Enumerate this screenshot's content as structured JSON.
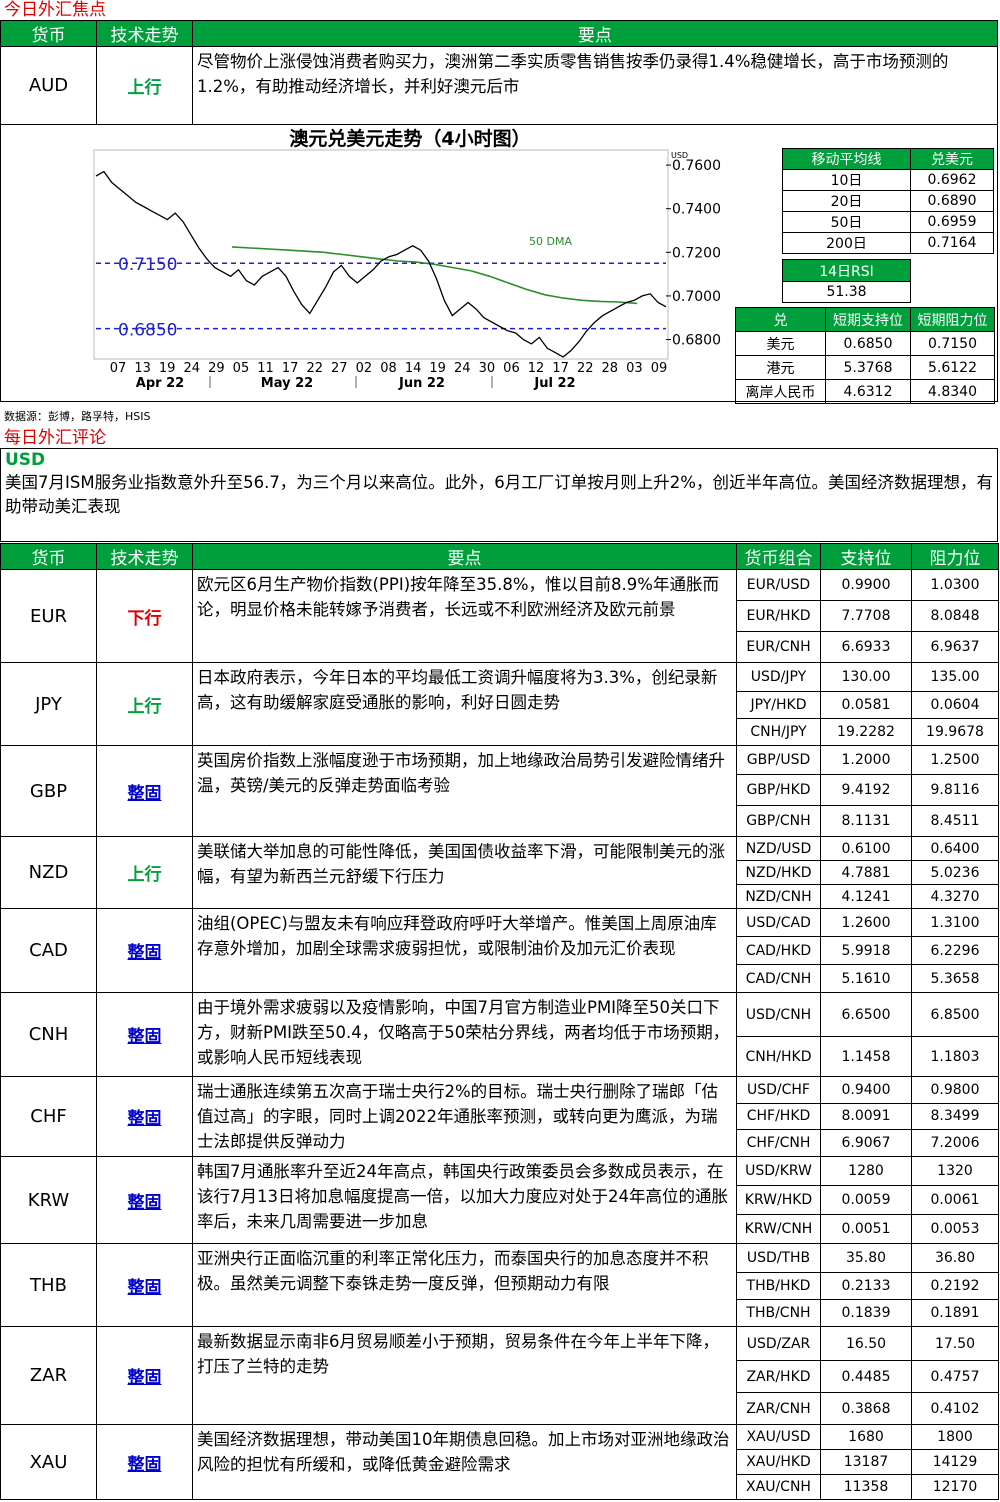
{
  "focus": {
    "title": "今日外汇焦点",
    "headers": {
      "currency": "货币",
      "trend": "技术走势",
      "points": "要点"
    },
    "aud": {
      "currency": "AUD",
      "trend": "上行",
      "points": "尽管物价上涨侵蚀消费者购买力，澳洲第二季实质零售销售按季仍录得1.4%稳健增长，高于市场预测的1.2%，有助推动经济增长，并利好澳元后市"
    }
  },
  "chart_data": {
    "type": "line",
    "title": "澳元兑美元走势（4小时图）",
    "y_unit": "USD",
    "ylim": [
      0.672,
      0.766
    ],
    "y_ticks": [
      "0.7600",
      "0.7400",
      "0.7200",
      "0.7000",
      "0.6800"
    ],
    "x_ticks": [
      "07",
      "13",
      "19",
      "24",
      "29",
      "05",
      "11",
      "17",
      "22",
      "27",
      "02",
      "08",
      "14",
      "19",
      "24",
      "30",
      "06",
      "12",
      "17",
      "22",
      "28",
      "03",
      "09"
    ],
    "month_labels": [
      "Apr 22",
      "May 22",
      "Jun 22",
      "Jul 22"
    ],
    "levels": [
      {
        "label": "0.7150",
        "value": 0.715
      },
      {
        "label": "0.6850",
        "value": 0.685
      }
    ],
    "dma_label": "50 DMA",
    "series": [
      {
        "values": [
          0.755,
          0.757,
          0.752,
          0.749,
          0.746,
          0.743,
          0.741,
          0.739,
          0.737,
          0.735,
          0.738,
          0.734,
          0.728,
          0.722,
          0.717,
          0.713,
          0.711,
          0.709,
          0.712,
          0.707,
          0.705,
          0.709,
          0.711,
          0.713,
          0.709,
          0.702,
          0.696,
          0.692,
          0.698,
          0.704,
          0.711,
          0.714,
          0.709,
          0.706,
          0.709,
          0.712,
          0.716,
          0.718,
          0.719,
          0.721,
          0.723,
          0.721,
          0.716,
          0.708,
          0.698,
          0.691,
          0.694,
          0.697,
          0.694,
          0.69,
          0.688,
          0.686,
          0.684,
          0.683,
          0.68,
          0.678,
          0.681,
          0.676,
          0.674,
          0.672,
          0.675,
          0.679,
          0.684,
          0.688,
          0.691,
          0.693,
          0.695,
          0.697,
          0.698,
          0.7,
          0.701,
          0.697,
          0.695
        ]
      },
      {
        "name": "50 DMA",
        "values": [
          0.7225,
          0.722,
          0.7215,
          0.721,
          0.7205,
          0.72,
          0.719,
          0.718,
          0.717,
          0.716,
          0.7155,
          0.7145,
          0.713,
          0.7115,
          0.709,
          0.706,
          0.703,
          0.7005,
          0.699,
          0.698,
          0.6975,
          0.6972,
          0.6966
        ]
      }
    ]
  },
  "ma_table": {
    "headers": [
      "移动平均线",
      "兑美元"
    ],
    "rows": [
      [
        "10日",
        "0.6962"
      ],
      [
        "20日",
        "0.6890"
      ],
      [
        "50日",
        "0.6959"
      ],
      [
        "200日",
        "0.7164"
      ]
    ]
  },
  "rsi": {
    "label": "14日RSI",
    "value": "51.38"
  },
  "sr_table": {
    "headers": [
      "兑",
      "短期支持位",
      "短期阻力位"
    ],
    "rows": [
      [
        "美元",
        "0.6850",
        "0.7150"
      ],
      [
        "港元",
        "5.3768",
        "5.6122"
      ],
      [
        "离岸人民币",
        "4.6312",
        "4.8340"
      ]
    ]
  },
  "source": "数据源：彭博，路孚特，HSIS",
  "commentary": {
    "title": "每日外汇评论",
    "usd_label": "USD",
    "usd_text": "美国7月ISM服务业指数意外升至56.7，为三个月以来高位。此外，6月工厂订单按月则上升2%，创近半年高位。美国经济数据理想，有助带动美汇表现"
  },
  "main_headers": [
    "货币",
    "技术走势",
    "要点",
    "货币组合",
    "支持位",
    "阻力位"
  ],
  "rows": [
    {
      "currency": "EUR",
      "trend": "下行",
      "trend_color": "#e00000",
      "points": "欧元区6月生产物价指数(PPI)按年降至35.8%，惟以目前8.9%年通胀而论，明显价格未能转嫁予消费者，长远或不利欧洲经济及欧元前景",
      "pairs": [
        [
          "EUR/USD",
          "0.9900",
          "1.0300"
        ],
        [
          "EUR/HKD",
          "7.7708",
          "8.0848"
        ],
        [
          "EUR/CNH",
          "6.6933",
          "6.9637"
        ]
      ]
    },
    {
      "currency": "JPY",
      "trend": "上行",
      "trend_color": "#009f3c",
      "points": "日本政府表示，今年日本的平均最低工资调升幅度将为3.3%，创纪录新高，这有助缓解家庭受通胀的影响，利好日圆走势",
      "pairs": [
        [
          "USD/JPY",
          "130.00",
          "135.00"
        ],
        [
          "JPY/HKD",
          "0.0581",
          "0.0604"
        ],
        [
          "CNH/JPY",
          "19.2282",
          "19.9678"
        ]
      ]
    },
    {
      "currency": "GBP",
      "trend": "整固",
      "trend_color": "#0000cc",
      "points": "英国房价指数上涨幅度逊于市场预期，加上地缘政治局势引发避险情绪升温，英镑/美元的反弹走势面临考验",
      "pairs": [
        [
          "GBP/USD",
          "1.2000",
          "1.2500"
        ],
        [
          "GBP/HKD",
          "9.4192",
          "9.8116"
        ],
        [
          "GBP/CNH",
          "8.1131",
          "8.4511"
        ]
      ]
    },
    {
      "currency": "NZD",
      "trend": "上行",
      "trend_color": "#009f3c",
      "points": "美联储大举加息的可能性降低，美国国债收益率下滑，可能限制美元的涨幅，有望为新西兰元舒缓下行压力",
      "pairs": [
        [
          "NZD/USD",
          "0.6100",
          "0.6400"
        ],
        [
          "NZD/HKD",
          "4.7881",
          "5.0236"
        ],
        [
          "NZD/CNH",
          "4.1241",
          "4.3270"
        ]
      ]
    },
    {
      "currency": "CAD",
      "trend": "整固",
      "trend_color": "#0000cc",
      "points": "油组(OPEC)与盟友未有响应拜登政府呼吁大举增产。惟美国上周原油库存意外增加，加剧全球需求疲弱担忧，或限制油价及加元汇价表现",
      "pairs": [
        [
          "USD/CAD",
          "1.2600",
          "1.3100"
        ],
        [
          "CAD/HKD",
          "5.9918",
          "6.2296"
        ],
        [
          "CAD/CNH",
          "5.1610",
          "5.3658"
        ]
      ]
    },
    {
      "currency": "CNH",
      "trend": "整固",
      "trend_color": "#0000cc",
      "points": "由于境外需求疲弱以及疫情影响，中国7月官方制造业PMI降至50关口下方，财新PMI跌至50.4，仅略高于50荣枯分界线，两者均低于市场预期，或影响人民币短线表现",
      "pairs": [
        [
          "USD/CNH",
          "6.6500",
          "6.8500"
        ],
        [
          "CNH/HKD",
          "1.1458",
          "1.1803"
        ]
      ]
    },
    {
      "currency": "CHF",
      "trend": "整固",
      "trend_color": "#0000cc",
      "points": "瑞士通胀连续第五次高于瑞士央行2%的目标。瑞士央行删除了瑞郎「估值过高」的字眼，同时上调2022年通胀率预测，或转向更为鹰派，为瑞士法郎提供反弹动力",
      "pairs": [
        [
          "USD/CHF",
          "0.9400",
          "0.9800"
        ],
        [
          "CHF/HKD",
          "8.0091",
          "8.3499"
        ],
        [
          "CHF/CNH",
          "6.9067",
          "7.2006"
        ]
      ]
    },
    {
      "currency": "KRW",
      "trend": "整固",
      "trend_color": "#0000cc",
      "points": "韩国7月通胀率升至近24年高点，韩国央行政策委员会多数成员表示，在该行7月13日将加息幅度提高一倍，以加大力度应对处于24年高位的通胀率后，未来几周需要进一步加息",
      "pairs": [
        [
          "USD/KRW",
          "1280",
          "1320"
        ],
        [
          "KRW/HKD",
          "0.0059",
          "0.0061"
        ],
        [
          "KRW/CNH",
          "0.0051",
          "0.0053"
        ]
      ]
    },
    {
      "currency": "THB",
      "trend": "整固",
      "trend_color": "#0000cc",
      "points": "亚洲央行正面临沉重的利率正常化压力，而泰国央行的加息态度并不积极。虽然美元调整下泰铢走势一度反弹，但预期动力有限",
      "pairs": [
        [
          "USD/THB",
          "35.80",
          "36.80"
        ],
        [
          "THB/HKD",
          "0.2133",
          "0.2192"
        ],
        [
          "THB/CNH",
          "0.1839",
          "0.1891"
        ]
      ]
    },
    {
      "currency": "ZAR",
      "trend": "整固",
      "trend_color": "#0000cc",
      "points": "最新数据显示南非6月贸易顺差小于预期，贸易条件在今年上半年下降，打压了兰特的走势",
      "pairs": [
        [
          "USD/ZAR",
          "16.50",
          "17.50"
        ],
        [
          "ZAR/HKD",
          "0.4485",
          "0.4757"
        ],
        [
          "ZAR/CNH",
          "0.3868",
          "0.4102"
        ]
      ]
    },
    {
      "currency": "XAU",
      "trend": "整固",
      "trend_color": "#0000cc",
      "points": "美国经济数据理想，带动美国10年期债息回稳。加上市场对亚洲地缘政治风险的担忧有所缓和，或降低黄金避险需求",
      "pairs": [
        [
          "XAU/USD",
          "1680",
          "1800"
        ],
        [
          "XAU/HKD",
          "13187",
          "14129"
        ],
        [
          "XAU/CNH",
          "11358",
          "12170"
        ]
      ]
    }
  ]
}
